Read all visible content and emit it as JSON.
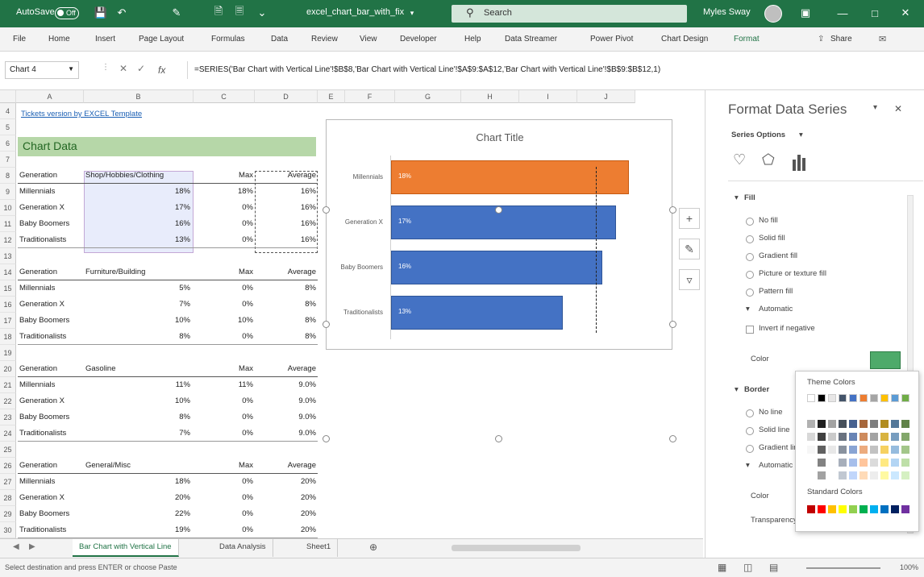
{
  "titlebar": {
    "autosave_label": "AutoSave",
    "toggle_state": "Off",
    "filename": "excel_chart_bar_with_fix",
    "search_placeholder": "Search",
    "user_name": "Myles Sway"
  },
  "ribbon": {
    "tabs": [
      "File",
      "Home",
      "Insert",
      "Page Layout",
      "Formulas",
      "Data",
      "Review",
      "View",
      "Developer",
      "Help",
      "Data Streamer",
      "Power Pivot",
      "Chart Design",
      "Format"
    ],
    "share_label": "Share"
  },
  "formula_bar": {
    "name_box": "Chart 4",
    "fx_label": "fx",
    "formula": "=SERIES('Bar Chart with Vertical Line'!$B$8,'Bar Chart with Vertical Line'!$A$9:$A$12,'Bar Chart with Vertical Line'!$B$9:$B$12,1)"
  },
  "grid": {
    "columns": [
      "A",
      "B",
      "C",
      "D",
      "E",
      "F",
      "G",
      "H",
      "I",
      "J"
    ],
    "rows": [
      "4",
      "5",
      "6",
      "7",
      "8",
      "9",
      "10",
      "11",
      "12",
      "13",
      "14",
      "15",
      "16",
      "17",
      "18",
      "19",
      "20",
      "21",
      "22",
      "23",
      "24",
      "25",
      "26",
      "27",
      "28",
      "29",
      "30"
    ],
    "link_text": "Tickets version by EXCEL Template",
    "chart_data_header": "Chart Data",
    "sections": [
      {
        "header": [
          "Generation",
          "Shop/Hobbies/Clothing",
          "Max",
          "Average"
        ],
        "rows": [
          [
            "Millennials",
            "18%",
            "18%",
            "16%"
          ],
          [
            "Generation X",
            "17%",
            "0%",
            "16%"
          ],
          [
            "Baby Boomers",
            "16%",
            "0%",
            "16%"
          ],
          [
            "Traditionalists",
            "13%",
            "0%",
            "16%"
          ]
        ]
      },
      {
        "header": [
          "Generation",
          "Furniture/Building",
          "Max",
          "Average"
        ],
        "rows": [
          [
            "Millennials",
            "5%",
            "0%",
            "8%"
          ],
          [
            "Generation X",
            "7%",
            "0%",
            "8%"
          ],
          [
            "Baby Boomers",
            "10%",
            "10%",
            "8%"
          ],
          [
            "Traditionalists",
            "8%",
            "0%",
            "8%"
          ]
        ]
      },
      {
        "header": [
          "Generation",
          "Gasoline",
          "Max",
          "Average"
        ],
        "rows": [
          [
            "Millennials",
            "11%",
            "11%",
            "9.0%"
          ],
          [
            "Generation X",
            "10%",
            "0%",
            "9.0%"
          ],
          [
            "Baby Boomers",
            "8%",
            "0%",
            "9.0%"
          ],
          [
            "Traditionalists",
            "7%",
            "0%",
            "9.0%"
          ]
        ]
      },
      {
        "header": [
          "Generation",
          "General/Misc",
          "Max",
          "Average"
        ],
        "rows": [
          [
            "Millennials",
            "18%",
            "0%",
            "20%"
          ],
          [
            "Generation X",
            "20%",
            "0%",
            "20%"
          ],
          [
            "Baby Boomers",
            "22%",
            "0%",
            "20%"
          ],
          [
            "Traditionalists",
            "19%",
            "0%",
            "20%"
          ]
        ]
      }
    ]
  },
  "chart_data": {
    "type": "bar",
    "title": "Chart Title",
    "categories": [
      "Millennials",
      "Generation X",
      "Baby Boomers",
      "Traditionalists"
    ],
    "values": [
      18,
      17,
      16,
      13
    ],
    "data_labels": [
      "18%",
      "17%",
      "16%",
      "13%"
    ],
    "xlim": [
      0,
      20
    ],
    "vertical_line_value": 15.5,
    "colors": [
      "#ED7D31",
      "#4472C4",
      "#4472C4",
      "#4472C4"
    ],
    "grid": false,
    "legend": "none"
  },
  "sheet_tabs": [
    "Bar Chart with Vertical Line",
    "Data Analysis",
    "Sheet1"
  ],
  "statusbar": {
    "message": "Select destination and press ENTER or choose Paste",
    "zoom": "100%"
  },
  "pane": {
    "title": "Format Data Series",
    "series_options": "Series Options",
    "fill_section": "Fill",
    "fill_options": [
      "No fill",
      "Solid fill",
      "Gradient fill",
      "Picture or texture fill",
      "Pattern fill",
      "Automatic"
    ],
    "invert_label": "Invert if negative",
    "color_label": "Color",
    "border_section": "Border",
    "border_options": [
      "No line",
      "Solid line",
      "Gradient line",
      "Automatic"
    ],
    "border_color_label": "Color",
    "transparency_label": "Transparency",
    "popup": {
      "theme_colors": "Theme Colors",
      "standard_colors": "Standard Colors"
    },
    "accent_color": "#217346"
  }
}
